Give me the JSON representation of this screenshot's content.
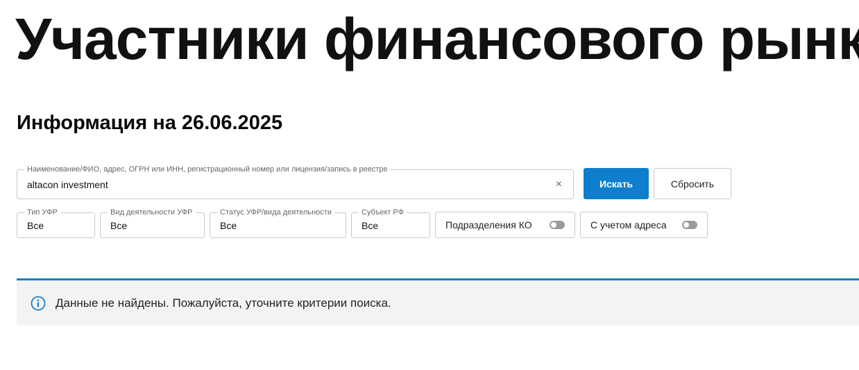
{
  "page": {
    "title": "Участники финансового рынка",
    "subtitle": "Информация на 26.06.2025"
  },
  "search": {
    "label": "Наименование/ФИО, адрес, ОГРН или ИНН, регистрационный номер или лицензия/запись в реестре",
    "value": "altacon investment",
    "clear_icon": "×",
    "search_button": "Искать",
    "reset_button": "Сбросить"
  },
  "filters": [
    {
      "label": "Тип УФР",
      "value": "Все"
    },
    {
      "label": "Вид деятельности УФР",
      "value": "Все"
    },
    {
      "label": "Статус УФР/вида деятельности",
      "value": "Все"
    },
    {
      "label": "Субъект РФ",
      "value": "Все"
    }
  ],
  "toggles": [
    {
      "label": "Подразделения КО",
      "on": false
    },
    {
      "label": "С учетом адреса",
      "on": false
    }
  ],
  "notice": {
    "icon": "info-icon",
    "text": "Данные не найдены. Пожалуйста, уточните критерии поиска."
  },
  "colors": {
    "accent": "#0f7fcd",
    "notice_border": "#1b7fc2",
    "notice_background": "#f3f3f3"
  }
}
